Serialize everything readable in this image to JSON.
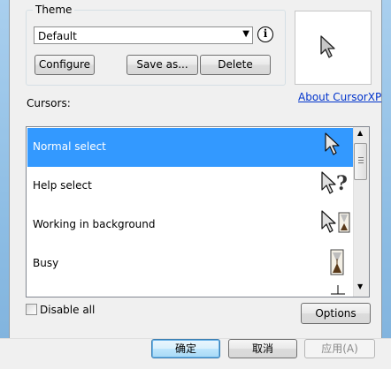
{
  "theme": {
    "legend": "Theme",
    "selected": "Default",
    "buttons": {
      "configure": "Configure",
      "save_as": "Save as...",
      "delete": "Delete"
    }
  },
  "about_link": "About CursorXP",
  "cursors_label": "Cursors:",
  "cursor_list": [
    {
      "label": "Normal select",
      "selected": true,
      "icon": "arrow-cursor-icon"
    },
    {
      "label": "Help select",
      "selected": false,
      "icon": "help-cursor-icon"
    },
    {
      "label": "Working in background",
      "selected": false,
      "icon": "working-cursor-icon"
    },
    {
      "label": "Busy",
      "selected": false,
      "icon": "hourglass-cursor-icon"
    }
  ],
  "disable_all": "Disable all",
  "options_button": "Options",
  "dialog_buttons": {
    "ok": "确定",
    "cancel": "取消",
    "apply": "应用(A)"
  },
  "colors": {
    "selection": "#3399ff",
    "link": "#0033cc",
    "accent_border": "#3c7fb1"
  }
}
